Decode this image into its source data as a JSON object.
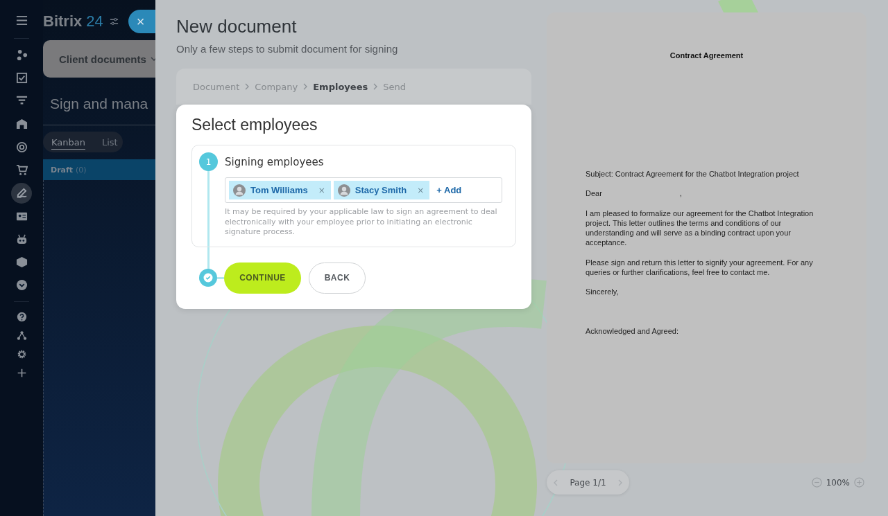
{
  "sidebar": {
    "items": [
      {
        "selected": false
      },
      {
        "selected": false
      },
      {
        "selected": false
      },
      {
        "selected": false
      },
      {
        "selected": false
      },
      {
        "selected": false
      },
      {
        "selected": true
      },
      {
        "selected": false
      },
      {
        "selected": false
      },
      {
        "selected": false
      },
      {
        "selected": false
      }
    ]
  },
  "header": {
    "logo_name": "Bitrix",
    "logo_number": "24",
    "close_label": "×",
    "menu_label": "Client documents",
    "page_title": "Sign and mana"
  },
  "view_tabs": [
    {
      "label": "Kanban",
      "selected": true
    },
    {
      "label": "List",
      "selected": false
    }
  ],
  "kanban_column": {
    "title": "Draft",
    "count": "(0)"
  },
  "panel": {
    "title": "New document",
    "subtitle": "Only a few steps to submit document for signing",
    "breadcrumbs": [
      {
        "label": "Document",
        "selected": false
      },
      {
        "label": "Company",
        "selected": false
      },
      {
        "label": "Employees",
        "selected": true
      },
      {
        "label": "Send",
        "selected": false
      }
    ],
    "dialog": {
      "title": "Select employees",
      "step_number": "1",
      "section_title": "Signing employees",
      "employees": [
        {
          "name": "Tom Williams",
          "remove": "×"
        },
        {
          "name": "Stacy Smith",
          "remove": "×"
        }
      ],
      "add_label": "+ Add",
      "note": "It may be required by your applicable law to sign an agreement to deal electronically with your employee prior to initiating an electronic signature process.",
      "buttons": [
        {
          "label": "CONTINUE",
          "kind": "primary"
        },
        {
          "label": "BACK",
          "kind": "secondary"
        }
      ]
    }
  },
  "preview": {
    "title": "Contract Agreement",
    "subject": "Subject: Contract Agreement for the Chatbot Integration project",
    "greeting": "Dear",
    "greeting_end": ",",
    "paragraphs": [
      "I am pleased to formalize our agreement for the Chatbot Integration project. This letter outlines the terms and conditions of our understanding and will serve as a binding contract upon your acceptance.",
      "Please sign and return this letter to signify your agreement. For any queries or further clarifications, feel free to contact me."
    ],
    "closing": "Sincerely,",
    "signoff": "Acknowledged and Agreed:",
    "page_label": "Page 1/1",
    "zoom": "100%"
  }
}
